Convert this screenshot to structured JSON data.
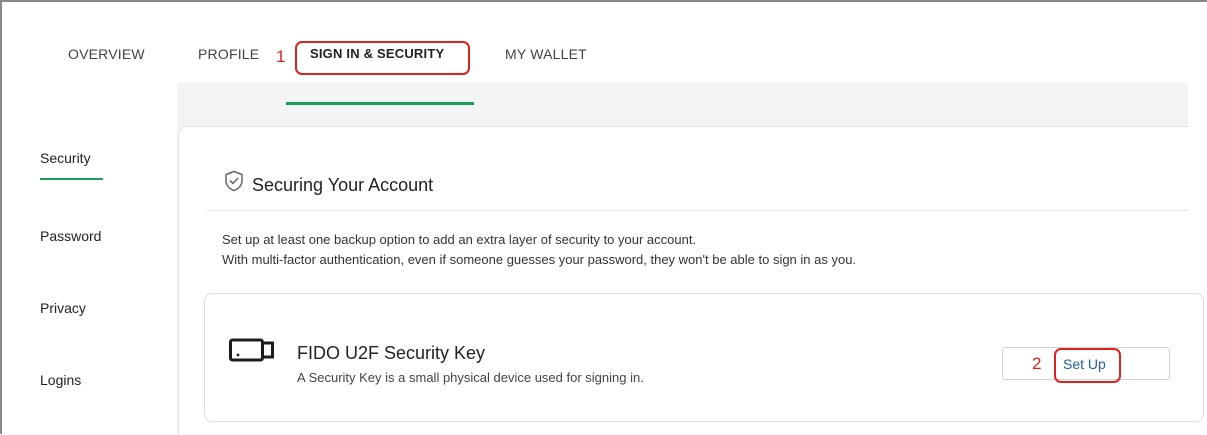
{
  "tabs": [
    {
      "label": "OVERVIEW"
    },
    {
      "label": "PROFILE"
    },
    {
      "label": "SIGN IN & SECURITY",
      "active": true
    },
    {
      "label": "MY WALLET"
    }
  ],
  "annotations": {
    "step1": "1",
    "step2": "2",
    "color": "#e0201b"
  },
  "sidebar": {
    "items": [
      {
        "label": "Security",
        "active": true
      },
      {
        "label": "Password"
      },
      {
        "label": "Privacy"
      },
      {
        "label": "Logins"
      }
    ]
  },
  "section": {
    "icon": "shield-check-icon",
    "title": "Securing Your Account",
    "description_line1": "Set up at least one backup option to add an extra layer of security to your account.",
    "description_line2": "With multi-factor authentication, even if someone guesses your password, they won't be able to sign in as you."
  },
  "security_key": {
    "icon": "security-key-icon",
    "title": "FIDO U2F Security Key",
    "description": "A Security Key is a small physical device used for signing in.",
    "button_label": "Set Up"
  },
  "colors": {
    "accent": "#1a9e5a",
    "link": "#1f5fa8",
    "background": "#f3f4f6"
  }
}
